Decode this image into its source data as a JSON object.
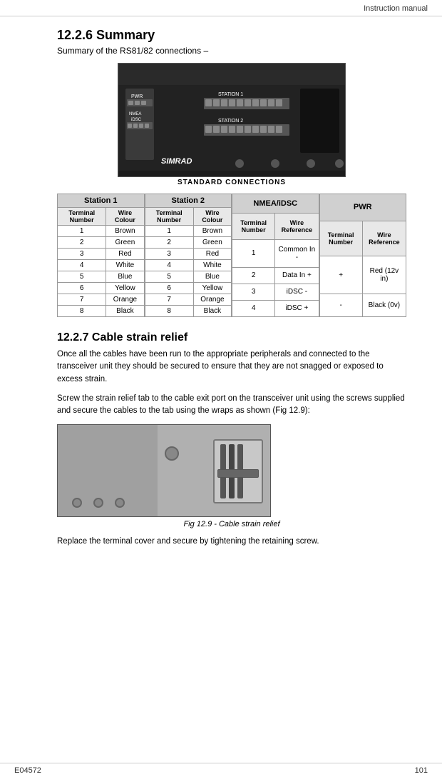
{
  "header": {
    "title": "Instruction manual"
  },
  "section_1": {
    "title": "12.2.6  Summary",
    "subtitle": "Summary of the RS81/82 connections –",
    "diagram_label": "STANDARD CONNECTIONS",
    "station1_label": "STATION 1",
    "station2_label": "STATION 2",
    "pwr_label": "PWR",
    "nmea_label": "NMEA",
    "dsc_label": "iDSC"
  },
  "tables": {
    "station1": {
      "header": "Station 1",
      "col1": "Terminal Number",
      "col2": "Wire Colour",
      "rows": [
        {
          "num": "1",
          "colour": "Brown"
        },
        {
          "num": "2",
          "colour": "Green"
        },
        {
          "num": "3",
          "colour": "Red"
        },
        {
          "num": "4",
          "colour": "White"
        },
        {
          "num": "5",
          "colour": "Blue"
        },
        {
          "num": "6",
          "colour": "Yellow"
        },
        {
          "num": "7",
          "colour": "Orange"
        },
        {
          "num": "8",
          "colour": "Black"
        }
      ]
    },
    "station2": {
      "header": "Station 2",
      "col1": "Terminal Number",
      "col2": "Wire Colour",
      "rows": [
        {
          "num": "1",
          "colour": "Brown"
        },
        {
          "num": "2",
          "colour": "Green"
        },
        {
          "num": "3",
          "colour": "Red"
        },
        {
          "num": "4",
          "colour": "White"
        },
        {
          "num": "5",
          "colour": "Blue"
        },
        {
          "num": "6",
          "colour": "Yellow"
        },
        {
          "num": "7",
          "colour": "Orange"
        },
        {
          "num": "8",
          "colour": "Black"
        }
      ]
    },
    "nmea_idsc": {
      "header": "NMEA/iDSC",
      "col1": "Terminal Number",
      "col2": "Wire Reference",
      "rows": [
        {
          "num": "1",
          "ref": "Common In -"
        },
        {
          "num": "2",
          "ref": "Data In +"
        },
        {
          "num": "3",
          "ref": "iDSC -"
        },
        {
          "num": "4",
          "ref": "iDSC +"
        }
      ]
    },
    "pwr": {
      "header": "PWR",
      "col1": "Terminal Number",
      "col2": "Wire Reference",
      "rows": [
        {
          "num": "+",
          "ref": "Red (12v in)"
        },
        {
          "num": "-",
          "ref": "Black (0v)"
        }
      ]
    }
  },
  "section_2": {
    "title": "12.2.7  Cable strain relief",
    "para1": "Once all the cables have been run to the appropriate peripherals and connected to the transceiver unit they should be secured to ensure that they are not snagged or exposed to excess strain.",
    "para2": "Screw the strain relief tab to the cable exit port on the transceiver unit using the screws supplied and secure the cables to the tab using the wraps as shown (Fig 12.9):",
    "fig_caption": "Fig 12.9 - Cable strain relief",
    "para3": "Replace the terminal cover and secure by tightening the retaining screw."
  },
  "footer": {
    "left": "E04572",
    "right": "101"
  }
}
